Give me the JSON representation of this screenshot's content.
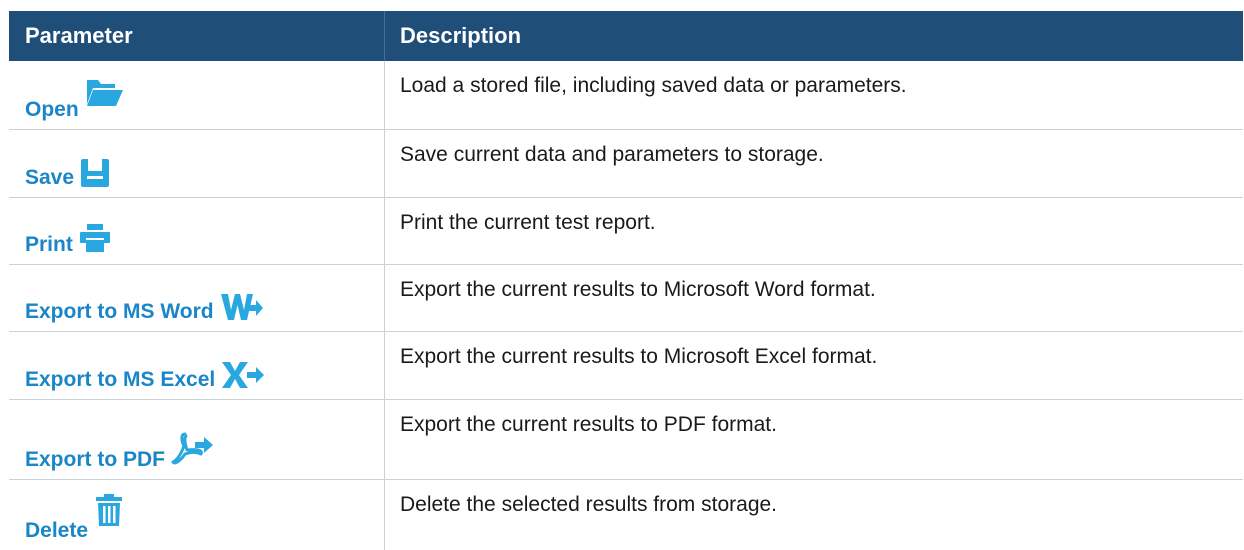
{
  "table": {
    "headers": {
      "parameter": "Parameter",
      "description": "Description"
    },
    "rows": [
      {
        "parameter": "Open",
        "icon": "folder-open-icon",
        "description": "Load a stored file, including saved data or parameters."
      },
      {
        "parameter": "Save",
        "icon": "floppy-disk-icon",
        "description": "Save current data and parameters to storage."
      },
      {
        "parameter": "Print",
        "icon": "printer-icon",
        "description": "Print the current test report."
      },
      {
        "parameter": "Export to MS Word",
        "icon": "word-export-icon",
        "description": "Export the current results to Microsoft Word format."
      },
      {
        "parameter": "Export to MS Excel",
        "icon": "excel-export-icon",
        "description": "Export the current results to Microsoft Excel format."
      },
      {
        "parameter": "Export to PDF",
        "icon": "pdf-export-icon",
        "description": "Export the current results to PDF format."
      },
      {
        "parameter": "Delete",
        "icon": "trash-icon",
        "description": "Delete the selected results from storage."
      }
    ]
  },
  "colors": {
    "header_bg": "#1f4e79",
    "header_text": "#ffffff",
    "param_text": "#1a86c7",
    "icon": "#29a8e0",
    "body_text": "#1a1a1a"
  }
}
